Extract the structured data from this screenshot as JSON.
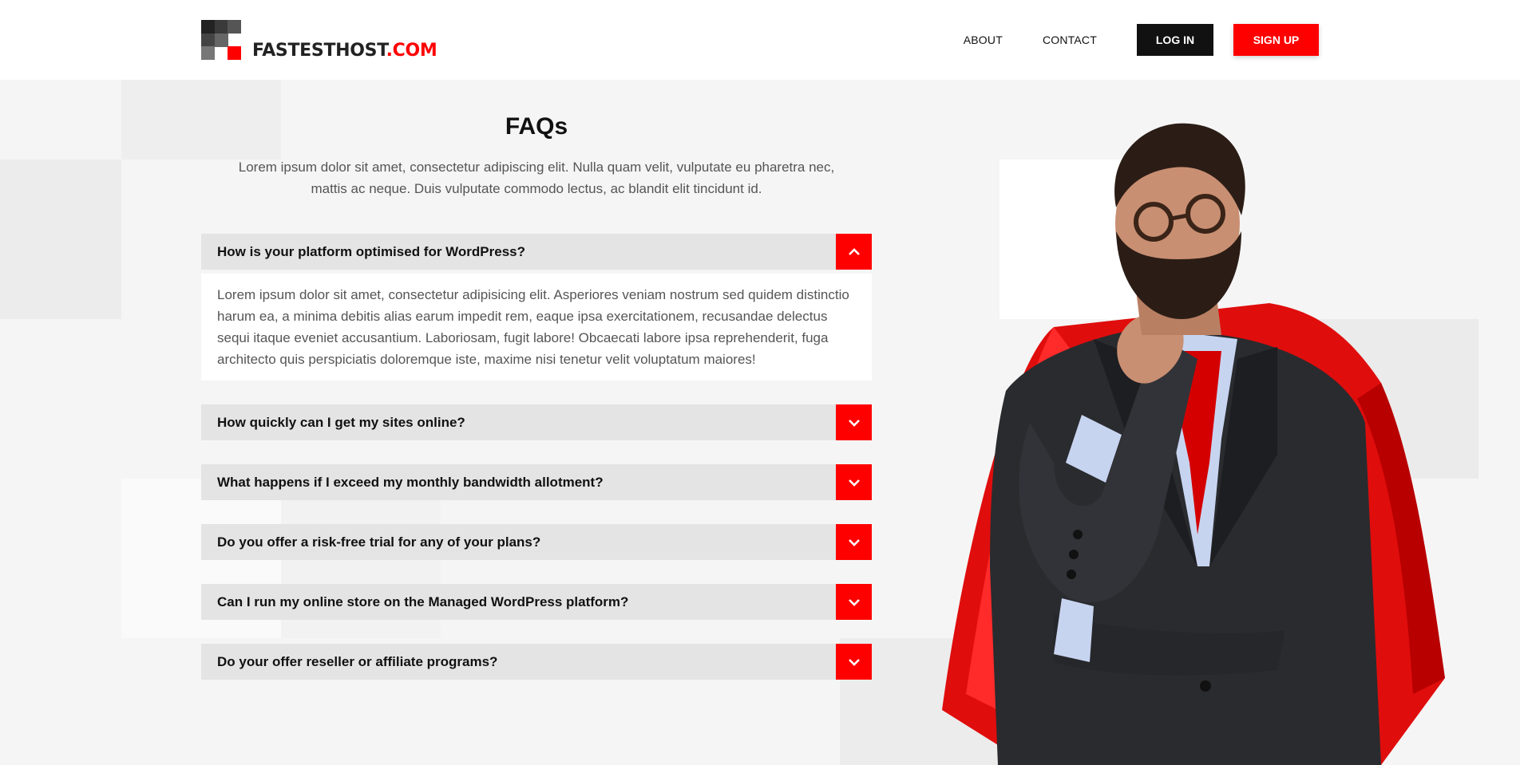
{
  "brand": {
    "name": "FASTESTHOST",
    "domain": ".COM"
  },
  "nav": {
    "about": "ABOUT",
    "contact": "CONTACT",
    "login": "LOG IN",
    "signup": "SIGN UP"
  },
  "faq": {
    "title": "FAQs",
    "intro_line1": "Lorem ipsum dolor sit amet, consectetur adipiscing elit. Nulla quam velit, vulputate eu pharetra nec,",
    "intro_line2": "mattis ac neque. Duis vulputate commodo lectus, ac blandit elit tincidunt id.",
    "items": [
      {
        "question": "How is your platform optimised for WordPress?",
        "answer": "Lorem ipsum dolor sit amet, consectetur adipisicing elit. Asperiores veniam nostrum sed quidem distinctio harum ea, a minima debitis alias earum impedit rem, eaque ipsa exercitationem, recusandae delectus sequi itaque eveniet accusantium. Laboriosam, fugit labore! Obcaecati labore ipsa reprehenderit, fuga architecto quis perspiciatis doloremque iste, maxime nisi tenetur velit voluptatum maiores!",
        "open": true
      },
      {
        "question": "How quickly can I get my sites online?",
        "open": false
      },
      {
        "question": "What happens if I exceed my monthly bandwidth allotment?",
        "open": false
      },
      {
        "question": "Do you offer a risk-free trial for any of your plans?",
        "open": false
      },
      {
        "question": "Can I run my online store on the Managed WordPress platform?",
        "open": false
      },
      {
        "question": "Do your offer reseller or affiliate programs?",
        "open": false
      }
    ]
  },
  "colors": {
    "accent": "#ff0000",
    "dark": "#111111",
    "question_bg": "#e4e4e4"
  },
  "icons": {
    "expanded": "chevron-up-icon",
    "collapsed": "chevron-down-icon"
  }
}
